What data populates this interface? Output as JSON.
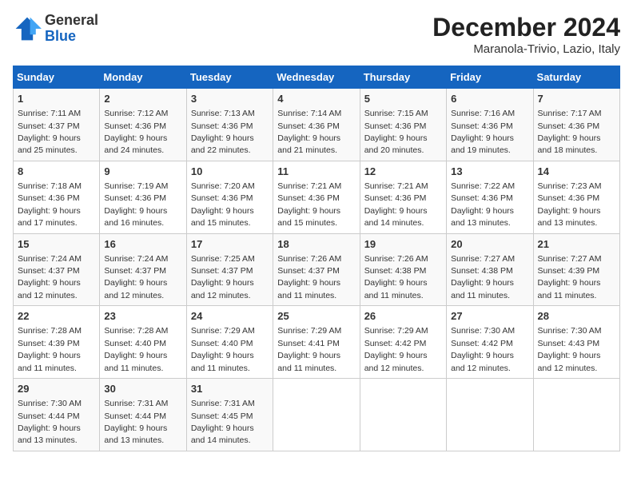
{
  "logo": {
    "general": "General",
    "blue": "Blue"
  },
  "title": "December 2024",
  "subtitle": "Maranola-Trivio, Lazio, Italy",
  "days_of_week": [
    "Sunday",
    "Monday",
    "Tuesday",
    "Wednesday",
    "Thursday",
    "Friday",
    "Saturday"
  ],
  "weeks": [
    [
      {
        "day": "1",
        "sunrise": "7:11 AM",
        "sunset": "4:37 PM",
        "daylight": "9 hours and 25 minutes."
      },
      {
        "day": "2",
        "sunrise": "7:12 AM",
        "sunset": "4:36 PM",
        "daylight": "9 hours and 24 minutes."
      },
      {
        "day": "3",
        "sunrise": "7:13 AM",
        "sunset": "4:36 PM",
        "daylight": "9 hours and 22 minutes."
      },
      {
        "day": "4",
        "sunrise": "7:14 AM",
        "sunset": "4:36 PM",
        "daylight": "9 hours and 21 minutes."
      },
      {
        "day": "5",
        "sunrise": "7:15 AM",
        "sunset": "4:36 PM",
        "daylight": "9 hours and 20 minutes."
      },
      {
        "day": "6",
        "sunrise": "7:16 AM",
        "sunset": "4:36 PM",
        "daylight": "9 hours and 19 minutes."
      },
      {
        "day": "7",
        "sunrise": "7:17 AM",
        "sunset": "4:36 PM",
        "daylight": "9 hours and 18 minutes."
      }
    ],
    [
      {
        "day": "8",
        "sunrise": "7:18 AM",
        "sunset": "4:36 PM",
        "daylight": "9 hours and 17 minutes."
      },
      {
        "day": "9",
        "sunrise": "7:19 AM",
        "sunset": "4:36 PM",
        "daylight": "9 hours and 16 minutes."
      },
      {
        "day": "10",
        "sunrise": "7:20 AM",
        "sunset": "4:36 PM",
        "daylight": "9 hours and 15 minutes."
      },
      {
        "day": "11",
        "sunrise": "7:21 AM",
        "sunset": "4:36 PM",
        "daylight": "9 hours and 15 minutes."
      },
      {
        "day": "12",
        "sunrise": "7:21 AM",
        "sunset": "4:36 PM",
        "daylight": "9 hours and 14 minutes."
      },
      {
        "day": "13",
        "sunrise": "7:22 AM",
        "sunset": "4:36 PM",
        "daylight": "9 hours and 13 minutes."
      },
      {
        "day": "14",
        "sunrise": "7:23 AM",
        "sunset": "4:36 PM",
        "daylight": "9 hours and 13 minutes."
      }
    ],
    [
      {
        "day": "15",
        "sunrise": "7:24 AM",
        "sunset": "4:37 PM",
        "daylight": "9 hours and 12 minutes."
      },
      {
        "day": "16",
        "sunrise": "7:24 AM",
        "sunset": "4:37 PM",
        "daylight": "9 hours and 12 minutes."
      },
      {
        "day": "17",
        "sunrise": "7:25 AM",
        "sunset": "4:37 PM",
        "daylight": "9 hours and 12 minutes."
      },
      {
        "day": "18",
        "sunrise": "7:26 AM",
        "sunset": "4:37 PM",
        "daylight": "9 hours and 11 minutes."
      },
      {
        "day": "19",
        "sunrise": "7:26 AM",
        "sunset": "4:38 PM",
        "daylight": "9 hours and 11 minutes."
      },
      {
        "day": "20",
        "sunrise": "7:27 AM",
        "sunset": "4:38 PM",
        "daylight": "9 hours and 11 minutes."
      },
      {
        "day": "21",
        "sunrise": "7:27 AM",
        "sunset": "4:39 PM",
        "daylight": "9 hours and 11 minutes."
      }
    ],
    [
      {
        "day": "22",
        "sunrise": "7:28 AM",
        "sunset": "4:39 PM",
        "daylight": "9 hours and 11 minutes."
      },
      {
        "day": "23",
        "sunrise": "7:28 AM",
        "sunset": "4:40 PM",
        "daylight": "9 hours and 11 minutes."
      },
      {
        "day": "24",
        "sunrise": "7:29 AM",
        "sunset": "4:40 PM",
        "daylight": "9 hours and 11 minutes."
      },
      {
        "day": "25",
        "sunrise": "7:29 AM",
        "sunset": "4:41 PM",
        "daylight": "9 hours and 11 minutes."
      },
      {
        "day": "26",
        "sunrise": "7:29 AM",
        "sunset": "4:42 PM",
        "daylight": "9 hours and 12 minutes."
      },
      {
        "day": "27",
        "sunrise": "7:30 AM",
        "sunset": "4:42 PM",
        "daylight": "9 hours and 12 minutes."
      },
      {
        "day": "28",
        "sunrise": "7:30 AM",
        "sunset": "4:43 PM",
        "daylight": "9 hours and 12 minutes."
      }
    ],
    [
      {
        "day": "29",
        "sunrise": "7:30 AM",
        "sunset": "4:44 PM",
        "daylight": "9 hours and 13 minutes."
      },
      {
        "day": "30",
        "sunrise": "7:31 AM",
        "sunset": "4:44 PM",
        "daylight": "9 hours and 13 minutes."
      },
      {
        "day": "31",
        "sunrise": "7:31 AM",
        "sunset": "4:45 PM",
        "daylight": "9 hours and 14 minutes."
      },
      null,
      null,
      null,
      null
    ]
  ]
}
